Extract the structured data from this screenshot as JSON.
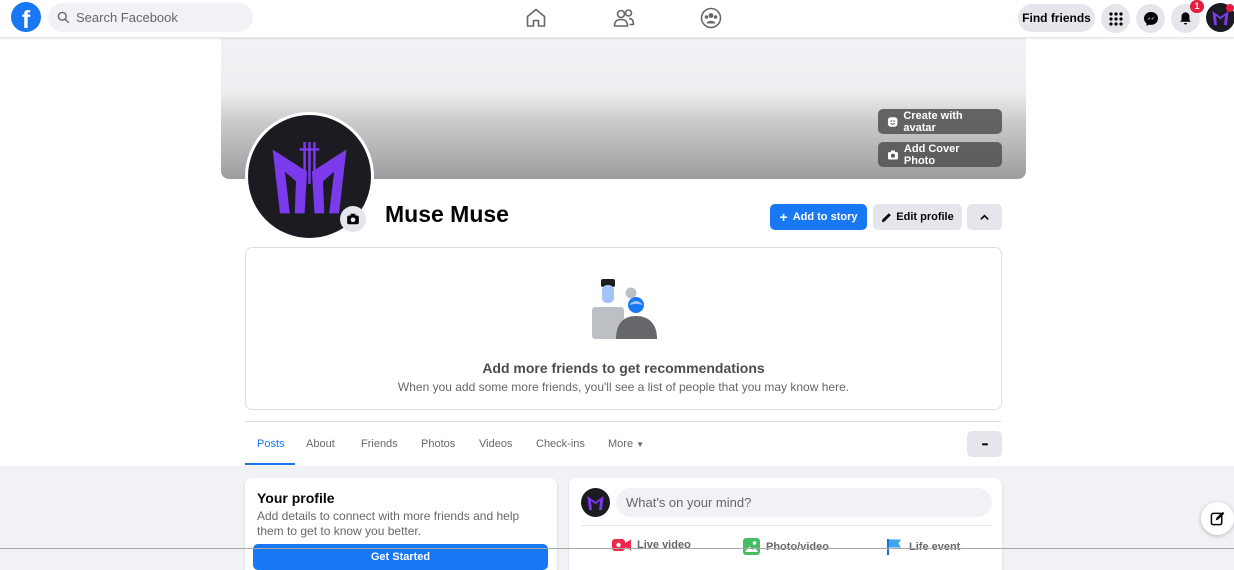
{
  "topbar": {
    "logo": "f",
    "search_placeholder": "Search Facebook",
    "find_friends_label": "Find friends",
    "notification_count": "1"
  },
  "cover": {
    "create_avatar_label": "Create with avatar",
    "add_cover_label": "Add Cover Photo"
  },
  "profile": {
    "name": "Muse Muse",
    "add_story_label": "Add to story",
    "edit_profile_label": "Edit profile"
  },
  "friends_card": {
    "title": "Add more friends to get recommendations",
    "subtitle": "When you add some more friends, you'll see a list of people that you may know here."
  },
  "tabs": {
    "items": [
      "Posts",
      "About",
      "Friends",
      "Photos",
      "Videos",
      "Check-ins",
      "More"
    ],
    "active": "Posts",
    "more_dots": "•••"
  },
  "your_profile": {
    "title": "Your profile",
    "description": "Add details to connect with more friends and help them to get to know you better.",
    "button_label": "Get Started"
  },
  "composer": {
    "placeholder": "What's on your mind?",
    "actions": {
      "live": "Live video",
      "photo": "Photo/video",
      "life": "Life event"
    }
  },
  "colors": {
    "brand": "#1877f2",
    "avatar_bg": "#1c1b22",
    "avatar_logo": "#7c3aed"
  }
}
